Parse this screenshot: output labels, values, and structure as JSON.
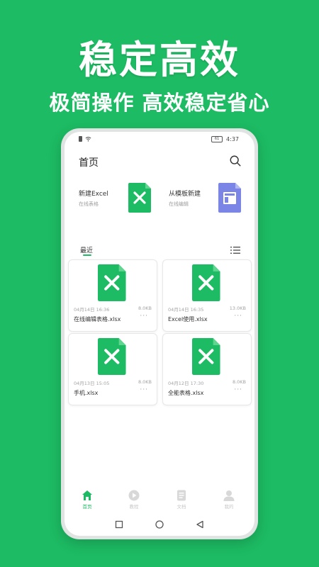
{
  "headline": {
    "title": "稳定高效",
    "subtitle": "极简操作 高效稳定省心"
  },
  "status_bar": {
    "time": "4:37"
  },
  "header": {
    "title": "首页"
  },
  "quick_actions": [
    {
      "label": "新建Excel",
      "sub": "在线表格",
      "icon": "excel-file-icon"
    },
    {
      "label": "从模板新建",
      "sub": "在线编辑",
      "icon": "template-file-icon"
    }
  ],
  "recent": {
    "tab_label": "最近",
    "files": [
      {
        "date": "04月14日 16:36",
        "size": "8.0KB",
        "name": "在线编辑表格.xlsx"
      },
      {
        "date": "04月14日 16:35",
        "size": "13.0KB",
        "name": "Excel使用.xlsx"
      },
      {
        "date": "04月13日 15:05",
        "size": "8.0KB",
        "name": "手机.xlsx"
      },
      {
        "date": "04月12日 17:30",
        "size": "8.0KB",
        "name": "全能表格.xlsx"
      }
    ]
  },
  "bottom_nav": [
    {
      "label": "首页",
      "active": true
    },
    {
      "label": "教程",
      "active": false
    },
    {
      "label": "文档",
      "active": false
    },
    {
      "label": "我的",
      "active": false
    }
  ],
  "colors": {
    "brand": "#1dbb63",
    "template_icon": "#7b85e6"
  }
}
